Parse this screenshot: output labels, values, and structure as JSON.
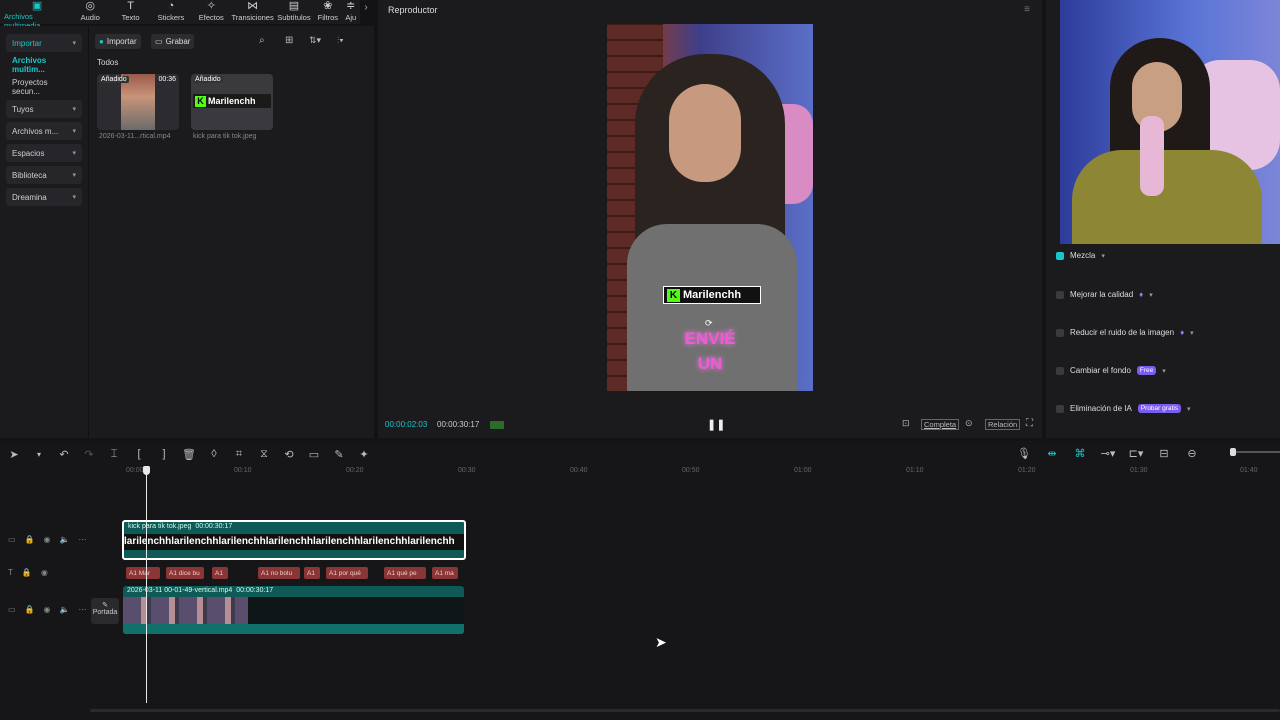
{
  "toolbar": {
    "items": [
      {
        "label": "Archivos multimedia",
        "icon": "media-icon"
      },
      {
        "label": "Audio",
        "icon": "audio-icon"
      },
      {
        "label": "Texto",
        "icon": "text-icon"
      },
      {
        "label": "Stickers",
        "icon": "sticker-icon"
      },
      {
        "label": "Efectos",
        "icon": "effects-icon"
      },
      {
        "label": "Transiciones",
        "icon": "transitions-icon"
      },
      {
        "label": "Subtítulos",
        "icon": "subtitles-icon"
      },
      {
        "label": "Filtros",
        "icon": "filters-icon"
      },
      {
        "label": "Aju",
        "icon": "adjust-icon"
      }
    ]
  },
  "leftnav": {
    "items": [
      {
        "label": "Importar"
      },
      {
        "label": "Archivos multim..."
      },
      {
        "label": "Proyectos secun..."
      },
      {
        "label": "Tuyos"
      },
      {
        "label": "Archivos m..."
      },
      {
        "label": "Espacios"
      },
      {
        "label": "Biblioteca"
      },
      {
        "label": "Dreamina"
      }
    ]
  },
  "media": {
    "import_label": "Importar",
    "record_label": "Grabar",
    "section_label": "Todos",
    "items": [
      {
        "badge": "Añadido",
        "duration": "00:36",
        "name": "2026-03-11...rtical.mp4"
      },
      {
        "badge": "Añadido",
        "logo_text": "Marilenchh",
        "name": "kick para tik tok.jpeg"
      }
    ]
  },
  "player": {
    "title": "Reproductor",
    "overlay_name": "Marilenchh",
    "caption_line1": "ENVIÉ",
    "caption_line2": "UN",
    "current_time": "00:00:02:03",
    "total_time": "00:00:30:17",
    "full_label": "Completa",
    "ratio_label": "Relación"
  },
  "rightpanel": {
    "options": [
      {
        "label": "Mezcla",
        "checked": true
      },
      {
        "label": "Mejorar la calidad",
        "checked": false
      },
      {
        "label": "Reducir el ruido de la imagen",
        "checked": false
      },
      {
        "label": "Cambiar el fondo",
        "checked": false,
        "tag": "Free"
      },
      {
        "label": "Eliminación de IA",
        "checked": false,
        "tag": "Probar gratis"
      }
    ]
  },
  "timeline": {
    "ruler": [
      "00:00",
      "00:10",
      "00:20",
      "00:30",
      "00:40",
      "00:50",
      "01:00",
      "01:10",
      "01:20",
      "01:30",
      "01:40"
    ],
    "sticker_clip": {
      "name": "kick para tik tok.jpeg",
      "duration": "00:00:30:17",
      "repeat_text": "larilenchhlarilenchhlarilenchhlarilenchhlarilenchhlarilenchhlarilenchh"
    },
    "captions": [
      "Mar",
      "dice bu",
      "",
      "no bolu",
      "",
      "por qué",
      "qué pe",
      "ma"
    ],
    "video_clip": {
      "name": "2026-03-11 00-01-49-vertical.mp4",
      "duration": "00:00:30:17"
    },
    "cover_label": "Portada"
  },
  "colors": {
    "accent": "#19c7c7",
    "caption": "#8a3636",
    "clip": "#0e5a57"
  }
}
